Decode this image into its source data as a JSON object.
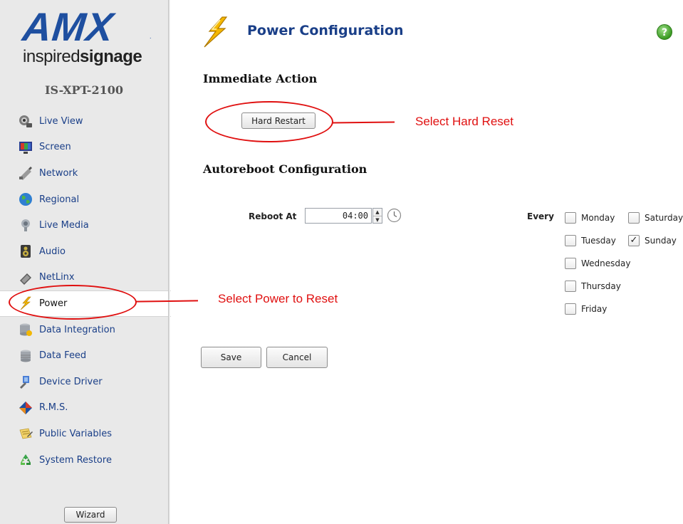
{
  "brand": {
    "logo_text": "AMX",
    "logo_registered": ".",
    "tagline_light": "inspired",
    "tagline_bold": "signage",
    "model": "IS-XPT-2100"
  },
  "sidebar": {
    "items": [
      {
        "label": "Live View",
        "icon": "live-view-icon"
      },
      {
        "label": "Screen",
        "icon": "screen-icon"
      },
      {
        "label": "Network",
        "icon": "network-icon"
      },
      {
        "label": "Regional",
        "icon": "globe-icon"
      },
      {
        "label": "Live Media",
        "icon": "live-media-icon"
      },
      {
        "label": "Audio",
        "icon": "speaker-icon"
      },
      {
        "label": "NetLinx",
        "icon": "netlinx-icon"
      },
      {
        "label": "Power",
        "icon": "power-bolt-icon",
        "active": true
      },
      {
        "label": "Data Integration",
        "icon": "data-integration-icon"
      },
      {
        "label": "Data Feed",
        "icon": "data-feed-icon"
      },
      {
        "label": "Device Driver",
        "icon": "device-driver-icon"
      },
      {
        "label": "R.M.S.",
        "icon": "rms-icon"
      },
      {
        "label": "Public Variables",
        "icon": "public-variables-icon"
      },
      {
        "label": "System Restore",
        "icon": "recycle-icon"
      }
    ],
    "wizard_label": "Wizard"
  },
  "main": {
    "title": "Power Configuration",
    "help": "?",
    "immediate_action": {
      "heading": "Immediate Action",
      "hard_restart_label": "Hard Restart"
    },
    "autoreboot": {
      "heading": "Autoreboot Configuration",
      "reboot_at_label": "Reboot At",
      "reboot_time": "04:00",
      "every_label": "Every",
      "days": [
        {
          "label": "Monday",
          "checked": false
        },
        {
          "label": "Saturday",
          "checked": false
        },
        {
          "label": "Tuesday",
          "checked": false
        },
        {
          "label": "Sunday",
          "checked": true
        },
        {
          "label": "Wednesday",
          "checked": false
        },
        {
          "label": "Thursday",
          "checked": false
        },
        {
          "label": "Friday",
          "checked": false
        }
      ]
    },
    "save_label": "Save",
    "cancel_label": "Cancel"
  },
  "annotations": {
    "hard_reset_note": "Select Hard Reset",
    "power_note": "Select Power to Reset",
    "color": "#e01010"
  },
  "colors": {
    "link_blue": "#1a3f88",
    "sidebar_bg": "#e9e9e9"
  }
}
